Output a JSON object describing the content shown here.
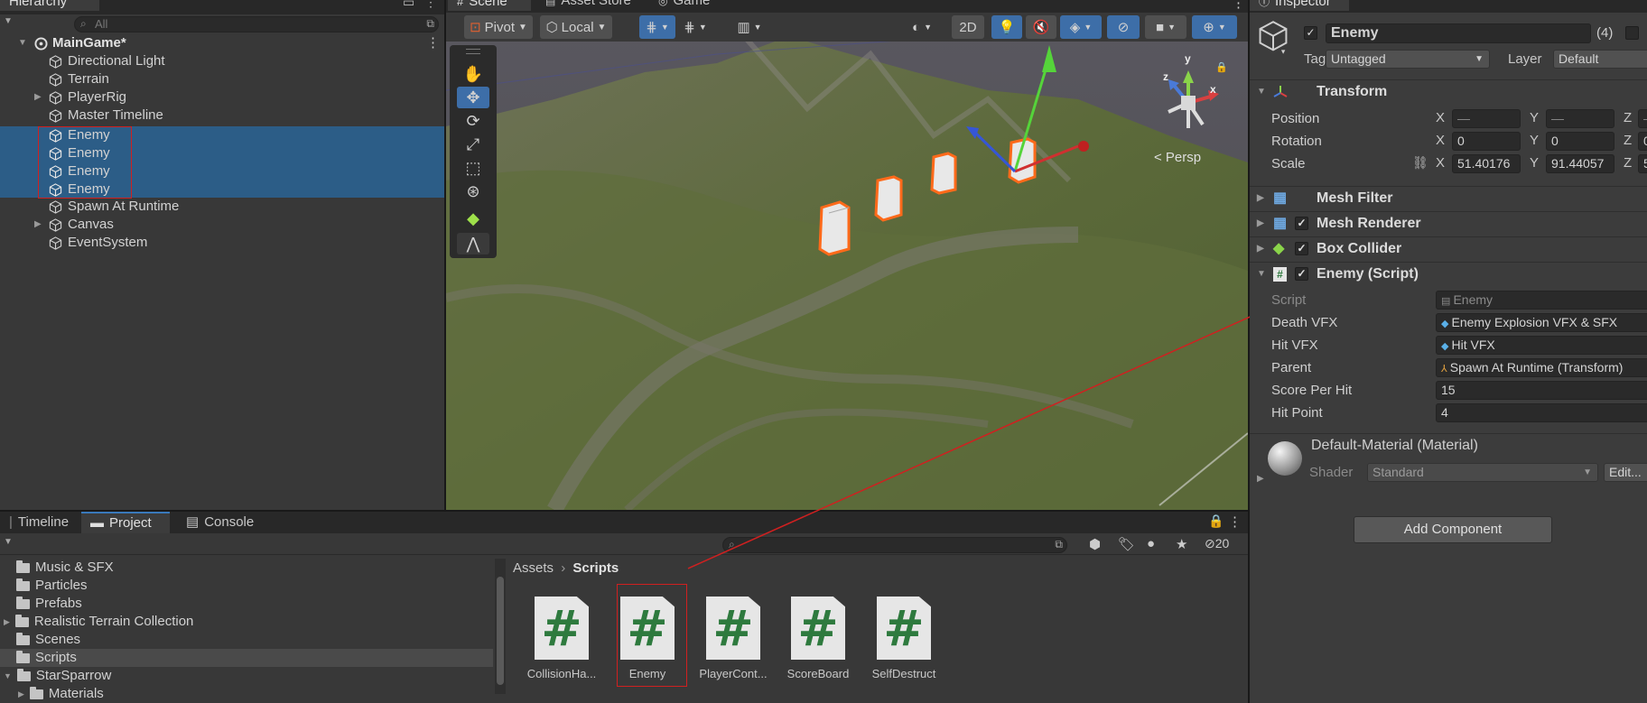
{
  "hierarchy": {
    "tab": "Hierarchy",
    "search_placeholder": "All",
    "scene_name": "MainGame*",
    "items": [
      {
        "label": "Directional Light"
      },
      {
        "label": "Terrain"
      },
      {
        "label": "PlayerRig"
      },
      {
        "label": "Master Timeline"
      },
      {
        "label": "Enemy"
      },
      {
        "label": "Enemy"
      },
      {
        "label": "Enemy"
      },
      {
        "label": "Enemy"
      },
      {
        "label": "Spawn At Runtime"
      },
      {
        "label": "Canvas"
      },
      {
        "label": "EventSystem"
      }
    ]
  },
  "scene_view": {
    "tabs": [
      "Scene",
      "Asset Store",
      "Game"
    ],
    "pivot_label": "Pivot",
    "local_label": "Local",
    "mode_2d": "2D",
    "persp_label": "< Persp",
    "gizmo_axes": {
      "x": "x",
      "y": "y",
      "z": "z"
    }
  },
  "bottom": {
    "tabs": [
      "Timeline",
      "Project",
      "Console"
    ],
    "folders": [
      "Music & SFX",
      "Particles",
      "Prefabs",
      "Realistic Terrain Collection",
      "Scenes",
      "Scripts",
      "StarSparrow",
      "Materials"
    ],
    "breadcrumb_root": "Assets",
    "breadcrumb_current": "Scripts",
    "hidden_count": "20",
    "assets": [
      {
        "name": "CollisionHa..."
      },
      {
        "name": "Enemy"
      },
      {
        "name": "PlayerCont..."
      },
      {
        "name": "ScoreBoard"
      },
      {
        "name": "SelfDestruct"
      }
    ]
  },
  "inspector": {
    "tab": "Inspector",
    "object_name": "Enemy",
    "count": "(4)",
    "tag_label": "Tag",
    "tag_value": "Untagged",
    "layer_label": "Layer",
    "layer_value": "Default",
    "transform": {
      "title": "Transform",
      "position_label": "Position",
      "rotation_label": "Rotation",
      "scale_label": "Scale",
      "position": {
        "x": "—",
        "y": "—",
        "z": "—"
      },
      "rotation": {
        "x": "0",
        "y": "0",
        "z": "0"
      },
      "scale": {
        "x": "51.40176",
        "y": "91.44057",
        "z": "5"
      }
    },
    "components": [
      "Mesh Filter",
      "Mesh Renderer",
      "Box Collider",
      "Enemy (Script)"
    ],
    "script_fields": {
      "script_label": "Script",
      "script_value": "Enemy",
      "death_label": "Death VFX",
      "death_value": "Enemy Explosion VFX & SFX",
      "hit_label": "Hit VFX",
      "hit_value": "Hit VFX",
      "parent_label": "Parent",
      "parent_value": "Spawn At Runtime (Transform)",
      "score_label": "Score Per Hit",
      "score_value": "15",
      "hp_label": "Hit Point",
      "hp_value": "4"
    },
    "material": {
      "name": "Default-Material (Material)",
      "shader_label": "Shader",
      "shader_value": "Standard",
      "edit_label": "Edit..."
    },
    "add_component": "Add Component"
  },
  "colors": {
    "selection": "#2c5d87",
    "accent": "#3d6ea8",
    "highlight_box": "#d02020",
    "script_hash": "#2e7a3e"
  }
}
